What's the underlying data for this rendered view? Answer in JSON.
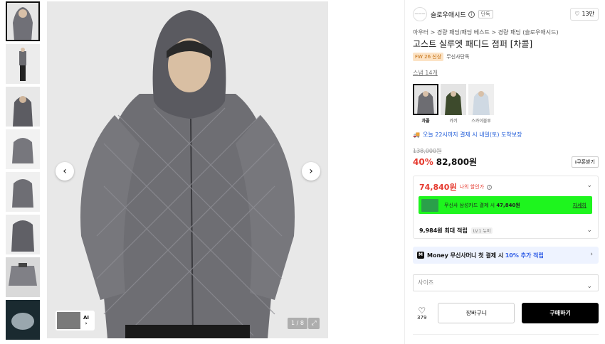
{
  "gallery": {
    "thumbnail_count": 8,
    "page_indicator": "1 / 8",
    "ai_label": "AI",
    "ai_arrow": "›",
    "prev_icon": "‹",
    "next_icon": "›",
    "expand_icon": "⤢"
  },
  "brand": {
    "logo_text": "———",
    "name": "슬로우애시드",
    "tag": "단독",
    "likes": "13만"
  },
  "product": {
    "breadcrumb": "아우터 > 경량 패딩/패딩 베스트 > 경량 패딩 (슬로우애시드)",
    "title": "고스트 실루엣 패디드 점퍼 [차콜]",
    "badge_season": "FW 26 신상",
    "badge_exclusive": "무신사단독",
    "snap": "스냅 14개"
  },
  "colors": [
    {
      "label": "차콜",
      "hex": "#6d6d72"
    },
    {
      "label": "카키",
      "hex": "#3d4a2c"
    },
    {
      "label": "스카이블루",
      "hex": "#cfd9e3"
    }
  ],
  "delivery": "오늘 22시까지 결제 시 내일(토) 도착보장",
  "pricing": {
    "original": "138,000원",
    "discount_pct": "40%",
    "sale_price": "82,800원",
    "coupon_label": "쿠폰받기",
    "my_price": "74,840원",
    "my_price_label": "나의 할인가",
    "card_text": "무신사 삼성카드 결제 시",
    "card_price": "47,840원",
    "card_link": "자세히",
    "points": "9,984원 최대 적립",
    "level": "LV.1 뉴비"
  },
  "money_banner": {
    "icon": "M",
    "prefix": "Money 무신사머니 첫 결제 시",
    "highlight": "10% 추가 적립"
  },
  "size_select": {
    "placeholder": "사이즈"
  },
  "actions": {
    "like_count": "379",
    "cart": "장바구니",
    "buy": "구매하기"
  },
  "accent": {
    "red": "#e53a2f",
    "green_banner": "#1ef51e",
    "blue": "#1f5bd8"
  }
}
